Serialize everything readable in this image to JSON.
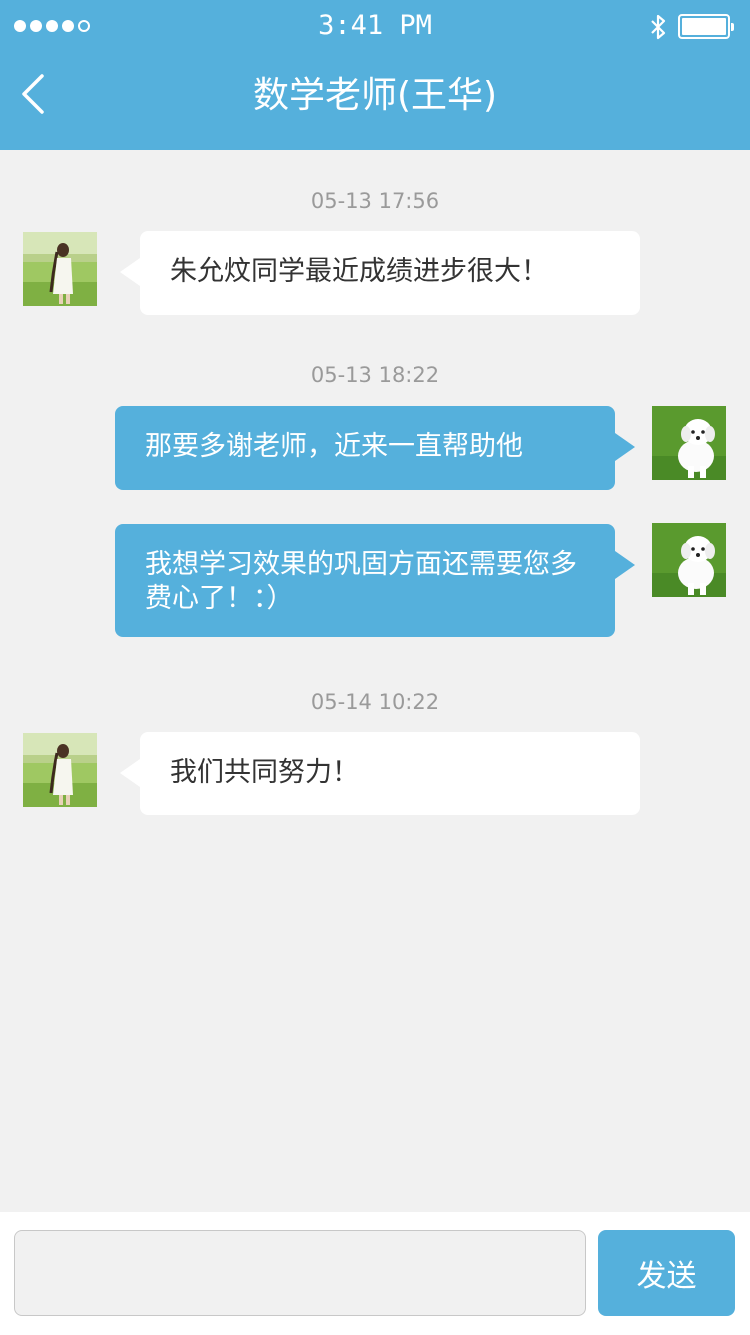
{
  "status_bar": {
    "time": "3:41 PM",
    "signal_icon": "signal-dots-icon",
    "bluetooth_icon": "bluetooth-icon",
    "battery_icon": "battery-full-icon"
  },
  "header": {
    "back_icon": "chevron-left-icon",
    "title": "数学老师(王华)"
  },
  "messages": [
    {
      "timestamp": "05-13 17:56",
      "side": "left",
      "avatar": "teacher-avatar",
      "text": "朱允炆同学最近成绩进步很大！"
    },
    {
      "timestamp": "05-13 18:22",
      "side": "right",
      "avatar": "parent-avatar",
      "text": "那要多谢老师，近来一直帮助他"
    },
    {
      "side": "right",
      "avatar": "parent-avatar",
      "text": "我想学习效果的巩固方面还需要您多费心了！：）"
    },
    {
      "timestamp": "05-14 10:22",
      "side": "left",
      "avatar": "teacher-avatar",
      "text": "我们共同努力！"
    }
  ],
  "input_bar": {
    "value": "",
    "placeholder": "",
    "send_label": "发送"
  },
  "colors": {
    "accent": "#55b0dc",
    "background": "#f1f1f1",
    "bubble_left": "#ffffff",
    "timestamp": "#9a9a9a"
  }
}
